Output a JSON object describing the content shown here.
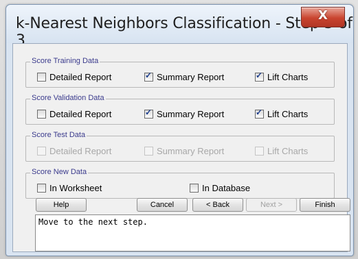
{
  "window": {
    "title": "k-Nearest Neighbors Classification - Step 3 of 3",
    "close_glyph": "X"
  },
  "groups": [
    {
      "title": "Score Training Data",
      "enabled": true,
      "options": [
        {
          "label": "Detailed Report",
          "checked": false
        },
        {
          "label": "Summary Report",
          "checked": true
        },
        {
          "label": "Lift Charts",
          "checked": true
        }
      ]
    },
    {
      "title": "Score Validation Data",
      "enabled": true,
      "options": [
        {
          "label": "Detailed Report",
          "checked": false
        },
        {
          "label": "Summary Report",
          "checked": true
        },
        {
          "label": "Lift Charts",
          "checked": true
        }
      ]
    },
    {
      "title": "Score Test Data",
      "enabled": false,
      "options": [
        {
          "label": "Detailed Report",
          "checked": false
        },
        {
          "label": "Summary Report",
          "checked": false
        },
        {
          "label": "Lift Charts",
          "checked": false
        }
      ]
    },
    {
      "title": "Score New Data",
      "enabled": true,
      "options": [
        {
          "label": "In Worksheet",
          "checked": false
        },
        {
          "label": "In Database",
          "checked": false
        }
      ]
    }
  ],
  "buttons": {
    "help": "Help",
    "cancel": "Cancel",
    "back": "< Back",
    "next": "Next >",
    "finish": "Finish"
  },
  "status_text": "Move to the next step.",
  "colors": {
    "close_button": "#c9442f",
    "group_title": "#3a3a8c",
    "check_mark": "#1c3d8c"
  }
}
